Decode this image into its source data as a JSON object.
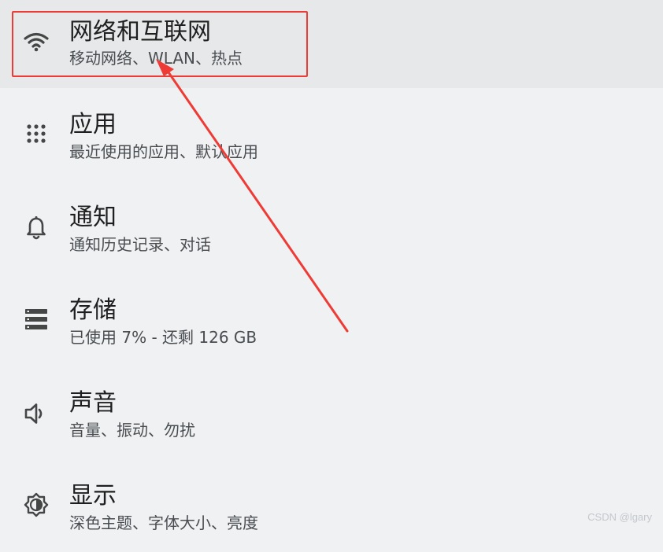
{
  "items": [
    {
      "title": "网络和互联网",
      "subtitle": "移动网络、WLAN、热点",
      "icon": "wifi-icon",
      "selected": true
    },
    {
      "title": "应用",
      "subtitle": "最近使用的应用、默认应用",
      "icon": "apps-grid-icon",
      "selected": false
    },
    {
      "title": "通知",
      "subtitle": "通知历史记录、对话",
      "icon": "bell-icon",
      "selected": false
    },
    {
      "title": "存储",
      "subtitle": "已使用 7% - 还剩 126 GB",
      "icon": "storage-icon",
      "selected": false
    },
    {
      "title": "声音",
      "subtitle": "音量、振动、勿扰",
      "icon": "volume-icon",
      "selected": false
    },
    {
      "title": "显示",
      "subtitle": "深色主题、字体大小、亮度",
      "icon": "brightness-icon",
      "selected": false
    }
  ],
  "annotation": {
    "color": "#ef3b36"
  },
  "watermark": "CSDN @lgary"
}
